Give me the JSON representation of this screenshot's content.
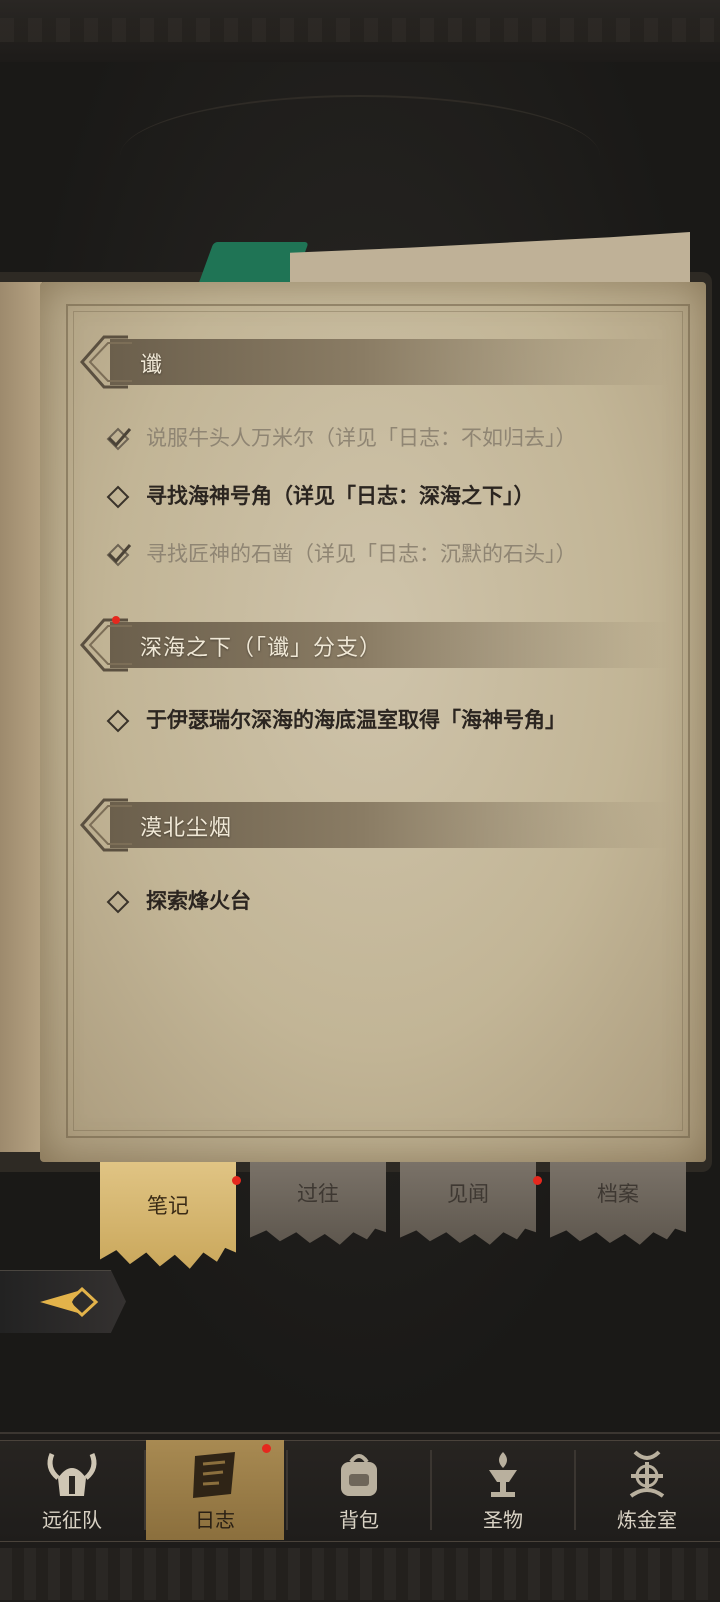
{
  "sections": [
    {
      "title": "谶",
      "has_badge": false
    },
    {
      "title": "深海之下（「谶」分支）",
      "has_badge": true
    },
    {
      "title": "漠北尘烟",
      "has_badge": false
    }
  ],
  "quests": [
    {
      "text": "说服牛头人万米尔（详见「日志：不如归去」）",
      "status": "completed"
    },
    {
      "text": "寻找海神号角（详见「日志：深海之下」）",
      "status": "active"
    },
    {
      "text": "寻找匠神的石凿（详见「日志：沉默的石头」）",
      "status": "completed"
    },
    {
      "text": "于伊瑟瑞尔深海的海底温室取得「海神号角」",
      "status": "active"
    },
    {
      "text": "探索烽火台",
      "status": "active"
    }
  ],
  "tabs": [
    {
      "label": "笔记",
      "active": true,
      "badge": true
    },
    {
      "label": "过往",
      "active": false,
      "badge": false
    },
    {
      "label": "见闻",
      "active": false,
      "badge": true
    },
    {
      "label": "档案",
      "active": false,
      "badge": false
    }
  ],
  "nav": [
    {
      "label": "远征队",
      "icon": "viking-helmet-icon",
      "active": false
    },
    {
      "label": "日志",
      "icon": "journal-icon",
      "active": true,
      "badge": true
    },
    {
      "label": "背包",
      "icon": "backpack-icon",
      "active": false
    },
    {
      "label": "圣物",
      "icon": "relic-icon",
      "active": false
    },
    {
      "label": "炼金室",
      "icon": "alchemy-icon",
      "active": false
    }
  ],
  "colors": {
    "badge": "#e5281e",
    "active_tab": "#e0c484",
    "bookmark": "#1f7455"
  }
}
